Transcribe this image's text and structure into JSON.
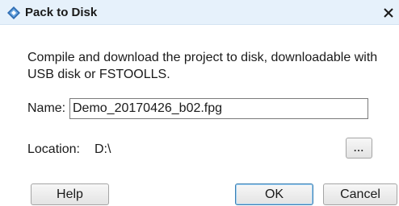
{
  "window": {
    "title": "Pack to Disk",
    "icon": "diamond-app-icon",
    "close_label": "✕"
  },
  "description": "Compile and download the project to disk, downloadable with USB disk or FSTOOLLS.",
  "name_field": {
    "label": "Name:",
    "value": "Demo_20170426_b02.fpg"
  },
  "location": {
    "label": "Location:",
    "value": "D:\\"
  },
  "buttons": {
    "browse": "...",
    "help": "Help",
    "ok": "OK",
    "cancel": "Cancel"
  },
  "colors": {
    "titlebar": "#e6f1fb",
    "default_button_border": "#3c7fb1"
  }
}
